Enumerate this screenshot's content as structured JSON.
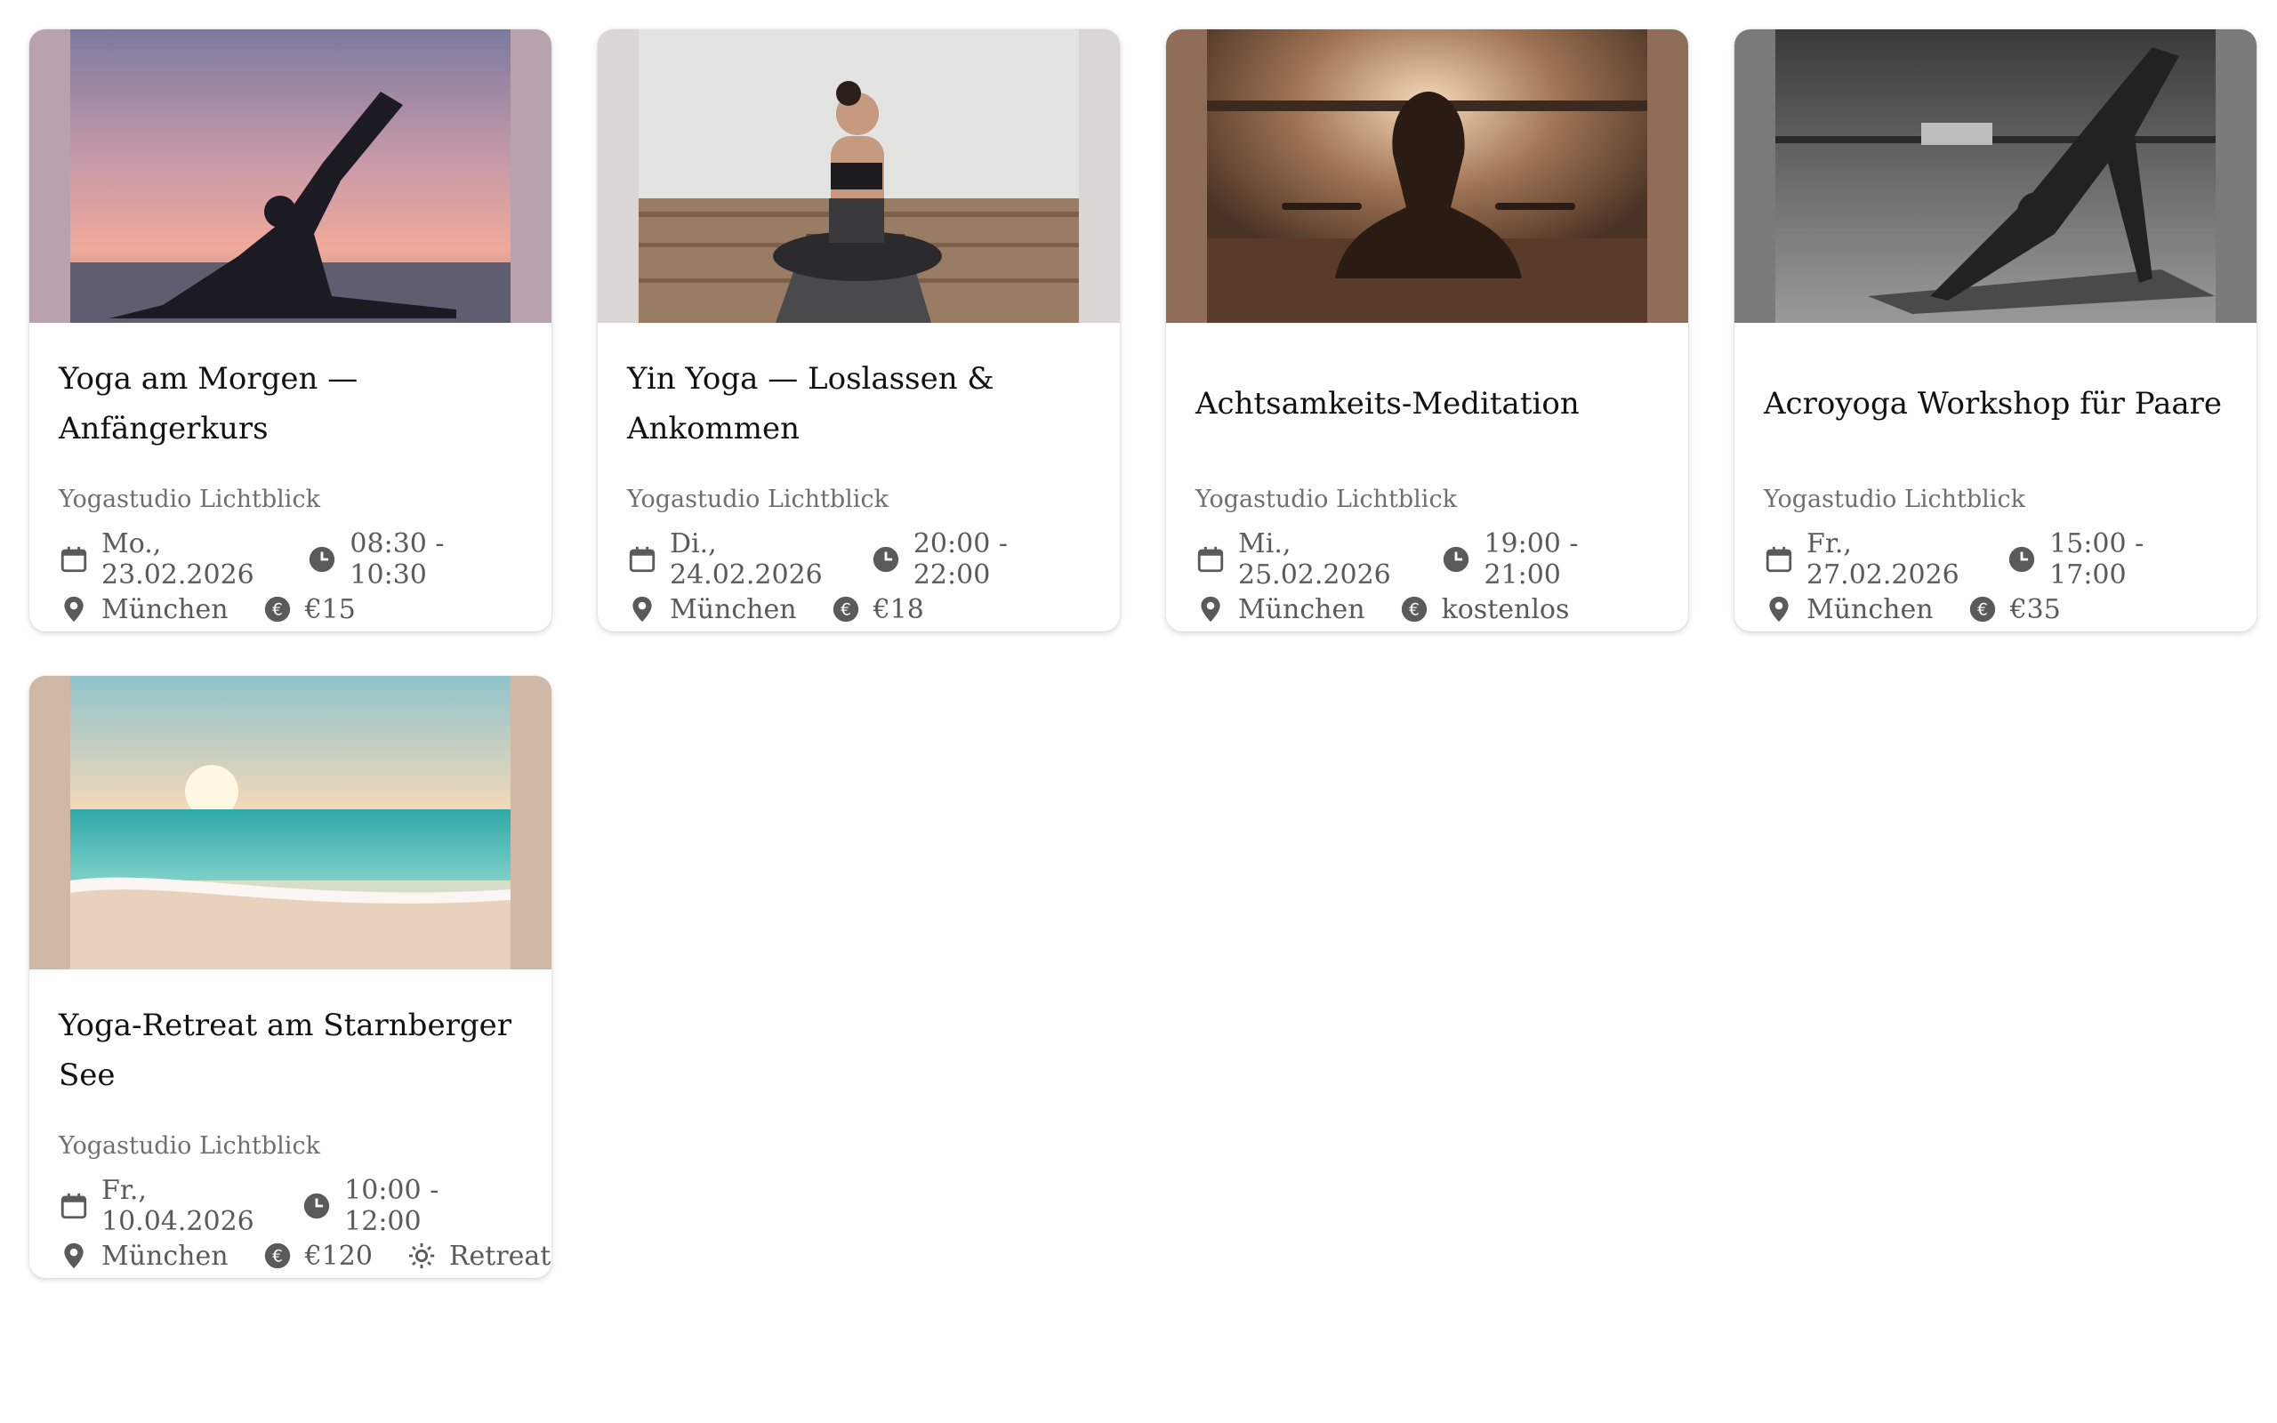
{
  "events": [
    {
      "title": "Yoga am Morgen — Anfängerkurs",
      "studio": "Yogastudio Lichtblick",
      "date": "Mo., 23.02.2026",
      "time": "08:30 - 10:30",
      "location": "München",
      "price": "€15",
      "image": "silhouette-sunset"
    },
    {
      "title": "Yin Yoga — Loslassen & Ankommen",
      "studio": "Yogastudio Lichtblick",
      "date": "Di., 24.02.2026",
      "time": "20:00 - 22:00",
      "location": "München",
      "price": "€18",
      "image": "seated-woman"
    },
    {
      "title": "Achtsamkeits-Meditation",
      "studio": "Yogastudio Lichtblick",
      "date": "Mi., 25.02.2026",
      "time": "19:00 - 21:00",
      "location": "München",
      "price": "kostenlos",
      "image": "meditation-backlight"
    },
    {
      "title": "Acroyoga Workshop für Paare",
      "studio": "Yogastudio Lichtblick",
      "date": "Fr., 27.02.2026",
      "time": "15:00 - 17:00",
      "location": "München",
      "price": "€35",
      "image": "downward-dog-bw"
    },
    {
      "title": "Yoga-Retreat am Starnberger See",
      "studio": "Yogastudio Lichtblick",
      "date": "Fr., 10.04.2026",
      "time": "10:00 - 12:00",
      "location": "München",
      "price": "€120",
      "category": "Retreat",
      "image": "beach-sunset"
    }
  ],
  "icons": {
    "date": "calendar-icon",
    "time": "clock-icon",
    "location": "location-pin-icon",
    "price": "euro-coin-icon",
    "category": "sun-icon"
  },
  "colors": {
    "title": "#111111",
    "meta": "#5a5a5a",
    "studio": "#6f6f6f"
  }
}
